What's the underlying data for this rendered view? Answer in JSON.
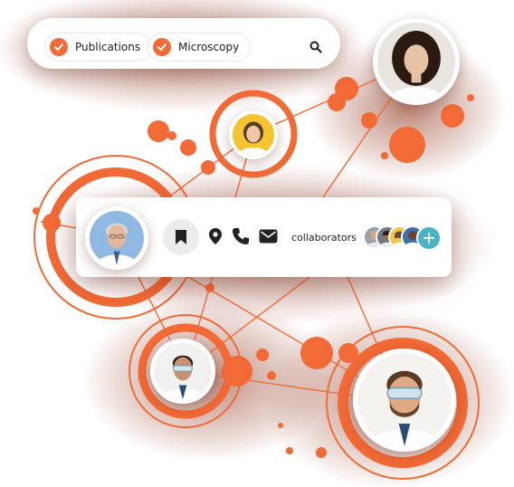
{
  "filters": {
    "chips": [
      {
        "label": "Publications"
      },
      {
        "label": "Microscopy"
      }
    ]
  },
  "card": {
    "collaborators_label": "collaborators"
  },
  "colors": {
    "accent": "#f26a35",
    "accent_dark": "#7a1f0a",
    "teal": "#4bb3c4",
    "card": "#ffffff"
  },
  "icons": [
    "check-icon",
    "search-icon",
    "bookmark-icon",
    "location-pin-icon",
    "phone-icon",
    "mail-icon",
    "plus-icon"
  ]
}
